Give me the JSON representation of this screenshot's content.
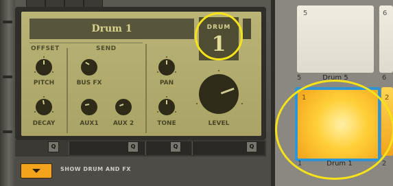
{
  "device": {
    "drum_name": "Drum 1",
    "drum_label": "DRUM",
    "drum_number": "1"
  },
  "sections": {
    "offset": "OFFSET",
    "send": "SEND"
  },
  "knobs": {
    "pitch": "PITCH",
    "decay": "DECAY",
    "bus_fx": "BUS FX",
    "aux1": "AUX1",
    "aux2": "AUX 2",
    "pan": "PAN",
    "tone": "TONE",
    "level": "LEVEL"
  },
  "q_buttons": [
    "Q",
    "Q",
    "Q",
    "Q"
  ],
  "show_toggle": {
    "label": "SHOW DRUM AND FX"
  },
  "pads": [
    {
      "number": "5",
      "name": "Drum 5",
      "bottom_left": "5",
      "bottom_right": "6"
    },
    {
      "number": "1",
      "name": "Drum 1",
      "bottom_left": "1",
      "bottom_right": "2",
      "selected": true
    }
  ],
  "partial_pads": {
    "top_right_number": "6",
    "mid_right_number": "2"
  },
  "colors": {
    "lcd": "#b3ae70",
    "selected_pad": "#ffcf38",
    "selected_border": "#2f94d6",
    "highlight_circle": "#f6e21a",
    "toggle_button": "#f3a41c"
  }
}
